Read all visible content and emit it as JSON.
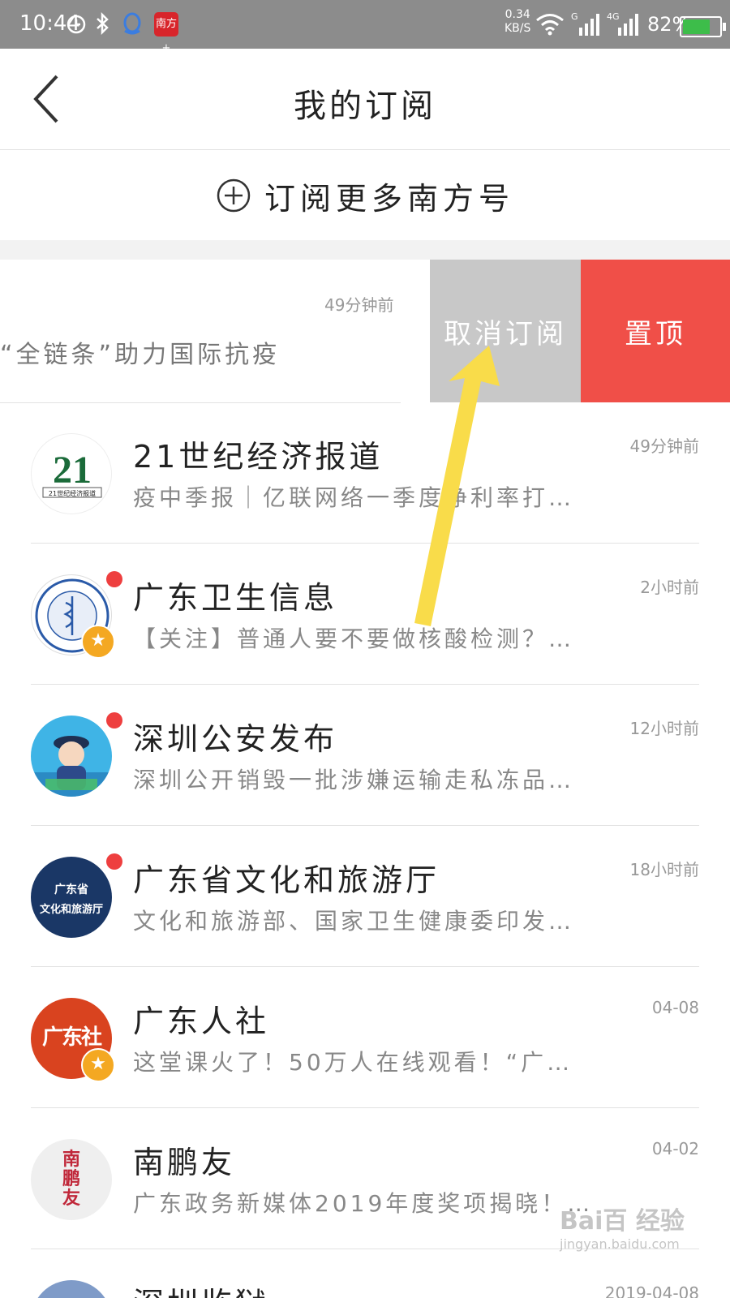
{
  "status_bar": {
    "time": "10:44",
    "net_speed_value": "0.34",
    "net_speed_unit": "KB/S",
    "signal1_label": "G",
    "signal2_label": "4G",
    "battery_percent_text": "82%",
    "battery_level": 0.82,
    "app_badge_text": "南方+"
  },
  "header": {
    "title": "我的订阅",
    "back_icon": "chevron-left-icon"
  },
  "subscribe_more": {
    "label": "订阅更多南方号",
    "icon": "plus-circle-icon"
  },
  "swiped_item": {
    "time": "49分钟前",
    "summary": "“全链条”助力国际抗疫",
    "unsubscribe_label": "取消订阅",
    "pin_label": "置顶",
    "colors": {
      "unsubscribe_bg": "#c8c8c8",
      "pin_bg": "#f04f48"
    }
  },
  "subscriptions": [
    {
      "name": "21世纪经济报道",
      "time": "49分钟前",
      "snippet": "疫中季报｜亿联网络一季度净利率打…",
      "unread": false,
      "starred": false,
      "avatar_text": "21",
      "avatar_sub": "21世纪经济报道"
    },
    {
      "name": "广东卫生信息",
      "time": "2小时前",
      "snippet": "【关注】普通人要不要做核酸检测？…",
      "unread": true,
      "starred": true
    },
    {
      "name": "深圳公安发布",
      "time": "12小时前",
      "snippet": "深圳公开销毁一批涉嫌运输走私冻品…",
      "unread": true,
      "starred": false
    },
    {
      "name": "广东省文化和旅游厅",
      "time": "18小时前",
      "snippet": "文化和旅游部、国家卫生健康委印发…",
      "unread": true,
      "starred": false,
      "avatar_line1": "广东省",
      "avatar_line2": "文化和旅游厅"
    },
    {
      "name": "广东人社",
      "time": "04-08",
      "snippet": "这堂课火了！50万人在线观看！“广…",
      "unread": false,
      "starred": true,
      "avatar_text": "广东社"
    },
    {
      "name": "南鹏友",
      "time": "04-02",
      "snippet": "广东政务新媒体2019年度奖项揭晓！…",
      "unread": false,
      "starred": false,
      "avatar_text": "南鹏友"
    },
    {
      "name": "深圳监狱",
      "time": "2019-04-08",
      "snippet": "",
      "unread": false,
      "starred": false
    }
  ],
  "annotation": {
    "arrow_color": "#f9dc4a"
  },
  "watermark": {
    "brand": "Bai百 经验",
    "url": "jingyan.baidu.com"
  }
}
